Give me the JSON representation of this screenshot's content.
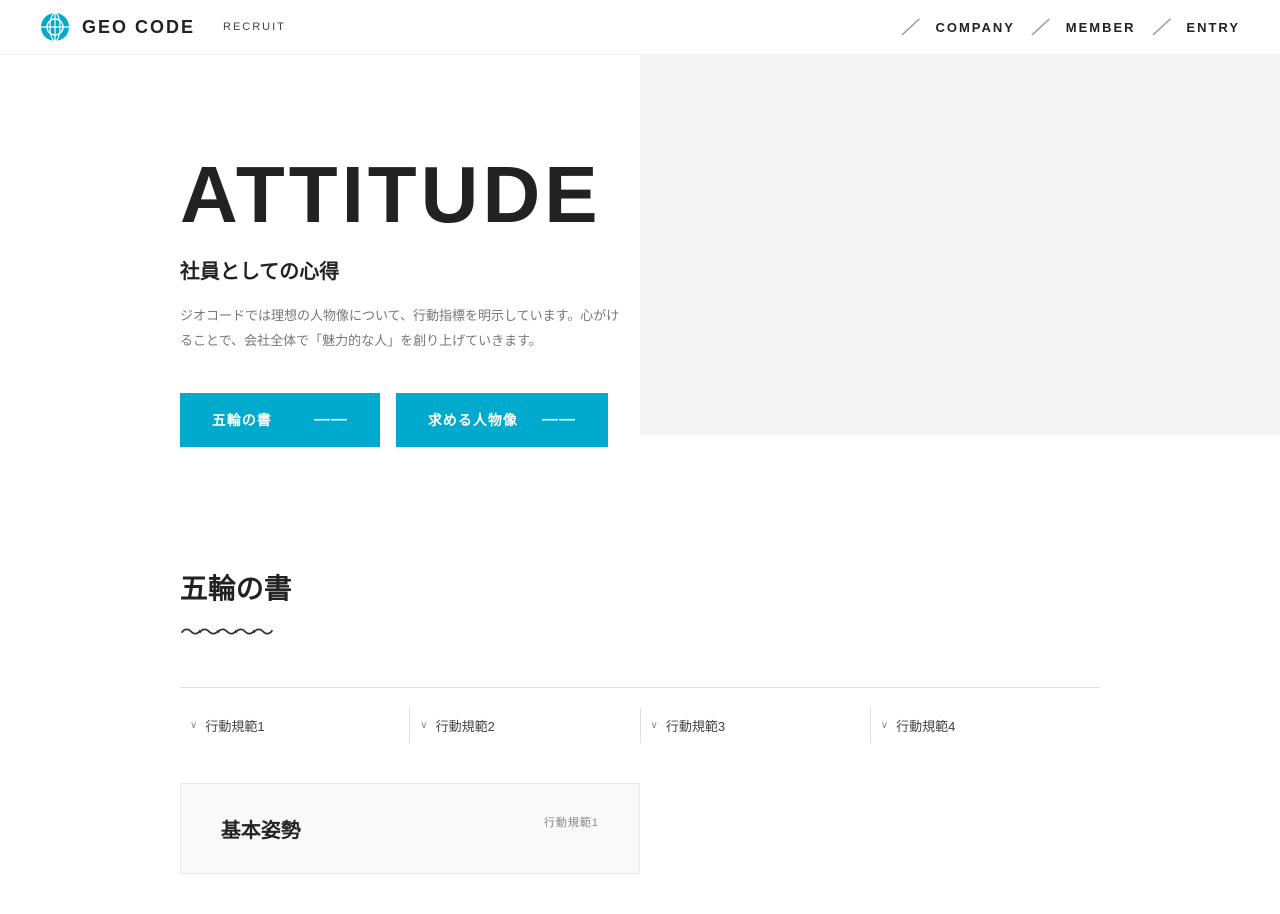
{
  "header": {
    "logo_text": "GEO CODE",
    "recruit_label": "RECRUIT",
    "nav_items": [
      {
        "label": "COMPANY",
        "id": "company"
      },
      {
        "label": "MEMBER",
        "id": "member"
      },
      {
        "label": "ENTRY",
        "id": "entry"
      }
    ]
  },
  "hero": {
    "title": "ATTITUDE",
    "subtitle": "社員としての心得",
    "description": "ジオコードでは理想の人物像について、行動指標を明示しています。心がけることで、会社全体で「魅力的な人」を創り上げていきます。",
    "btn1_label": "五輪の書",
    "btn2_label": "求める人物像"
  },
  "section_gorinsho": {
    "title": "五輪の書",
    "rules": [
      {
        "label": "行動規範1"
      },
      {
        "label": "行動規範2"
      },
      {
        "label": "行動規範3"
      },
      {
        "label": "行動規範4"
      }
    ]
  },
  "card_preview": {
    "title": "基本姿勢",
    "badge": "行動規範1"
  }
}
